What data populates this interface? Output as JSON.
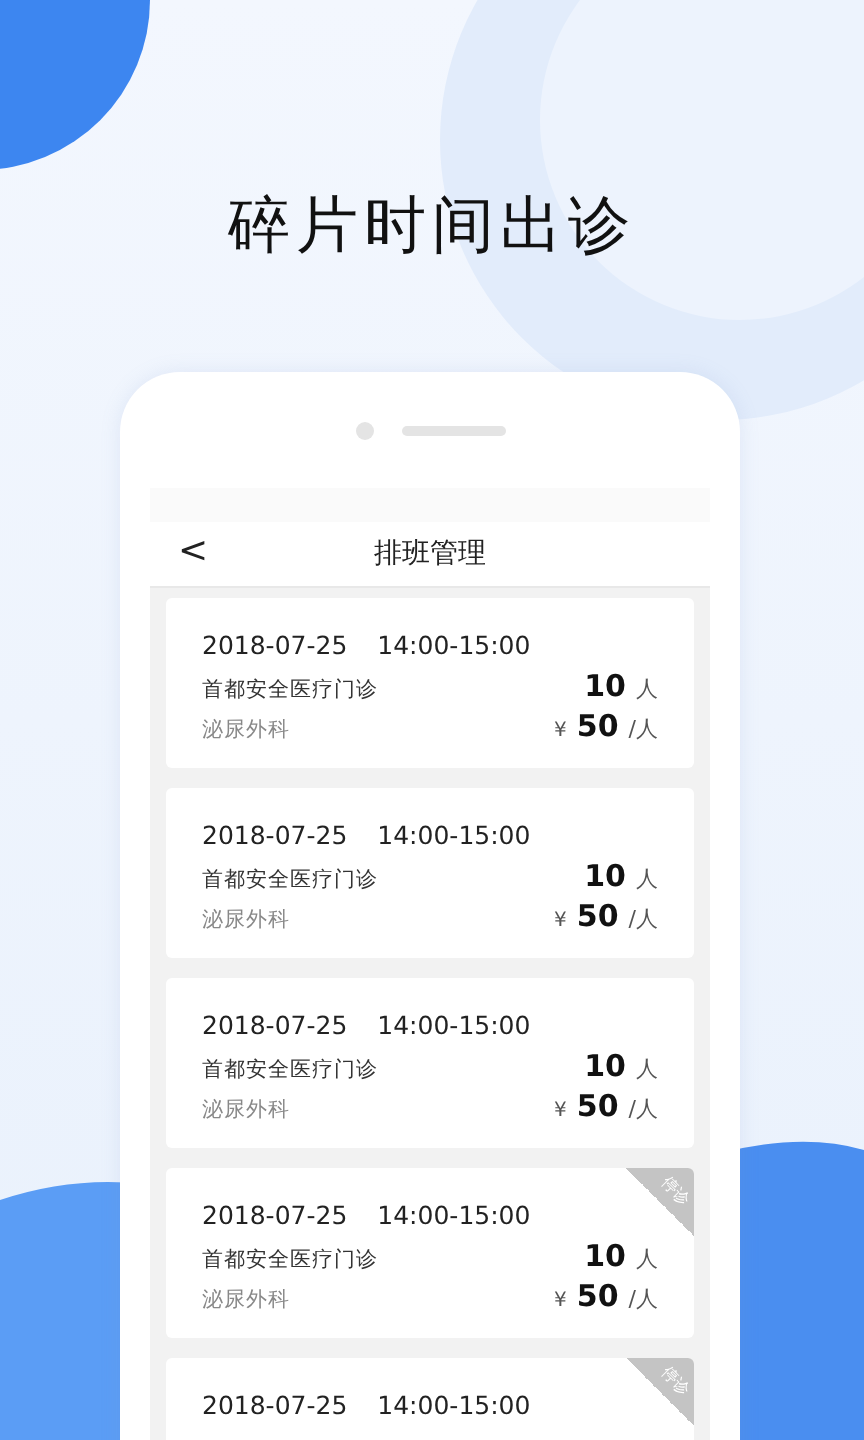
{
  "headline": "碎片时间出诊",
  "nav": {
    "back": "<",
    "title": "排班管理"
  },
  "cards": [
    {
      "date": "2018-07-25",
      "time": "14:00-15:00",
      "clinic": "首都安全医疗门诊",
      "department": "泌尿外科",
      "count": "10",
      "count_unit": "人",
      "currency": "¥",
      "price": "50",
      "price_unit": "/人"
    },
    {
      "date": "2018-07-25",
      "time": "14:00-15:00",
      "clinic": "首都安全医疗门诊",
      "department": "泌尿外科",
      "count": "10",
      "count_unit": "人",
      "currency": "¥",
      "price": "50",
      "price_unit": "/人"
    },
    {
      "date": "2018-07-25",
      "time": "14:00-15:00",
      "clinic": "首都安全医疗门诊",
      "department": "泌尿外科",
      "count": "10",
      "count_unit": "人",
      "currency": "¥",
      "price": "50",
      "price_unit": "/人"
    },
    {
      "date": "2018-07-25",
      "time": "14:00-15:00",
      "clinic": "首都安全医疗门诊",
      "department": "泌尿外科",
      "count": "10",
      "count_unit": "人",
      "currency": "¥",
      "price": "50",
      "price_unit": "/人",
      "badge": "停诊"
    },
    {
      "date": "2018-07-25",
      "time": "14:00-15:00",
      "badge": "停诊"
    }
  ]
}
